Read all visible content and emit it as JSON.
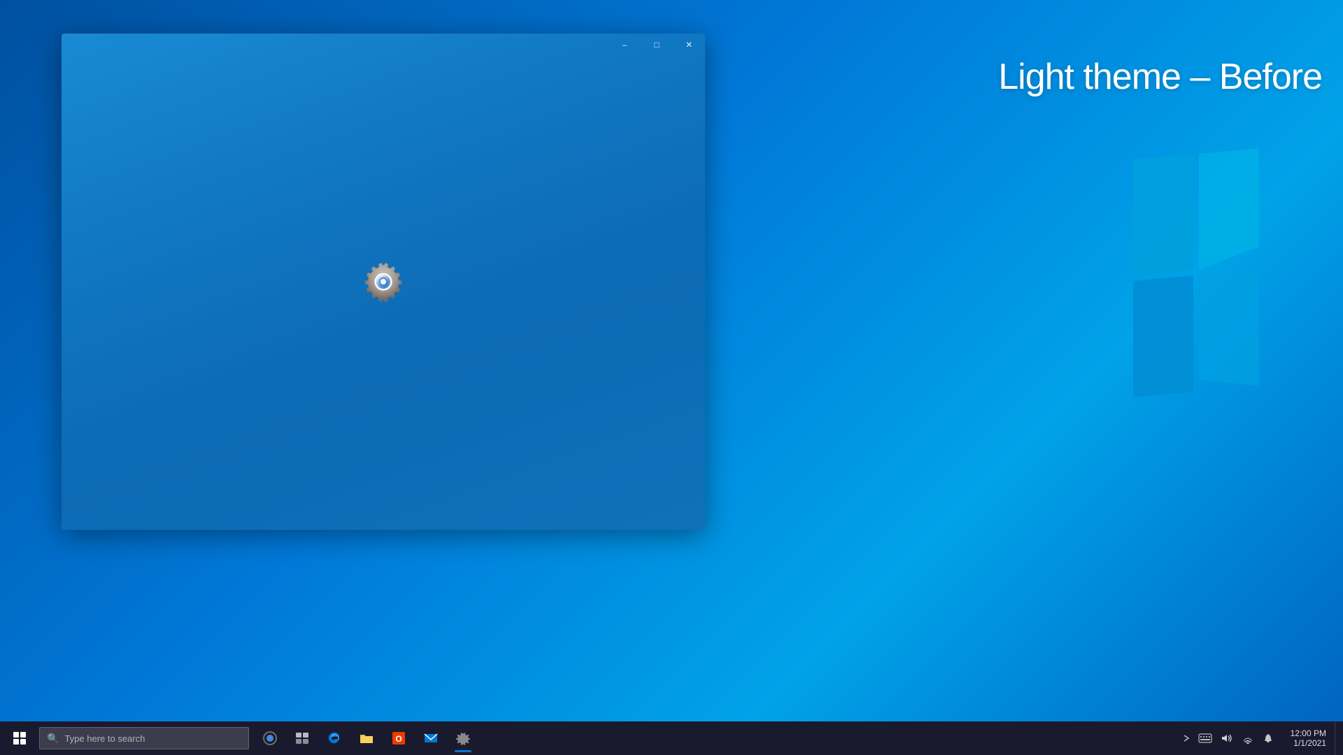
{
  "desktop": {
    "background_color": "#0078d7"
  },
  "overlay": {
    "title": "Light theme – Before"
  },
  "settings_window": {
    "title": "Settings",
    "controls": {
      "minimize": "–",
      "maximize": "□",
      "close": "✕"
    }
  },
  "taskbar": {
    "search_placeholder": "Type here to search",
    "apps": [
      {
        "name": "cortana",
        "label": "Cortana",
        "icon": "○"
      },
      {
        "name": "task-view",
        "label": "Task View",
        "icon": "⧉"
      },
      {
        "name": "edge",
        "label": "Microsoft Edge",
        "icon": "e"
      },
      {
        "name": "explorer",
        "label": "File Explorer",
        "icon": "📁"
      },
      {
        "name": "office",
        "label": "Office",
        "icon": "O"
      },
      {
        "name": "mail",
        "label": "Mail",
        "icon": "✉"
      },
      {
        "name": "settings",
        "label": "Settings",
        "icon": "⚙"
      }
    ],
    "tray": {
      "chevron": "^",
      "keyboard": "⌨",
      "sound": "🔊",
      "network": "🌐",
      "notification": "💬"
    }
  }
}
